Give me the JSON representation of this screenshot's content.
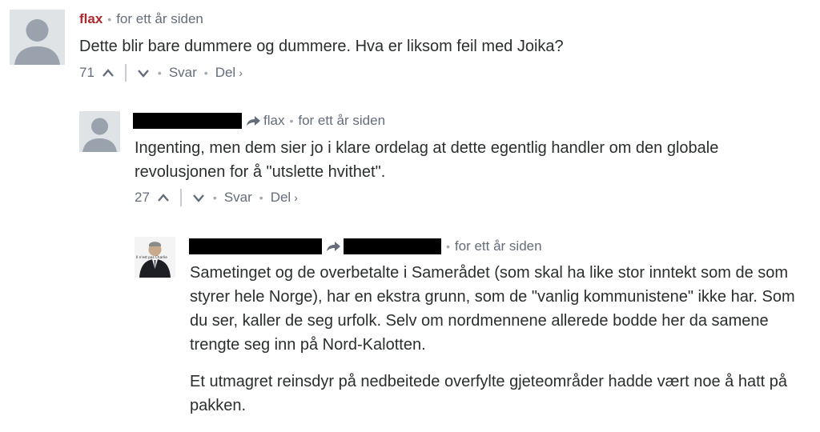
{
  "comments": [
    {
      "author": "flax",
      "time": "for ett år siden",
      "body": [
        "Dette blir bare dummere og dummere. Hva er liksom feil med Joika?"
      ],
      "votes": "71",
      "reply_label": "Svar",
      "share_label": "Del",
      "share_chevron": "›"
    },
    {
      "reply_to": "flax",
      "time": "for ett år siden",
      "body": [
        "Ingenting, men dem sier jo i klare ordelag at dette egentlig handler om den globale revolusjonen for å \"utslette hvithet\"."
      ],
      "votes": "27",
      "reply_label": "Svar",
      "share_label": "Del",
      "share_chevron": "›"
    },
    {
      "avatar_caption": "Il n'est pas Charlie",
      "time": "for ett år siden",
      "body": [
        "Sametinget og de overbetalte i Samerådet (som skal ha like stor inntekt som de som styrer hele Norge), har en ekstra grunn, som de \"vanlig kommunistene\" ikke har. Som du ser, kaller de seg urfolk. Selv om nordmennene allerede bodde her da samene trengte seg inn på Nord-Kalotten.",
        "Et utmagret reinsdyr på nedbeitede overfylte gjeteområder hadde vært noe å hatt på pakken."
      ]
    }
  ],
  "colors": {
    "author": "#b1282b",
    "meta": "#656c7a",
    "text": "#2a2e2e",
    "avatar_bg": "#dfe3e6",
    "avatar_fg": "#9aa3ad"
  }
}
